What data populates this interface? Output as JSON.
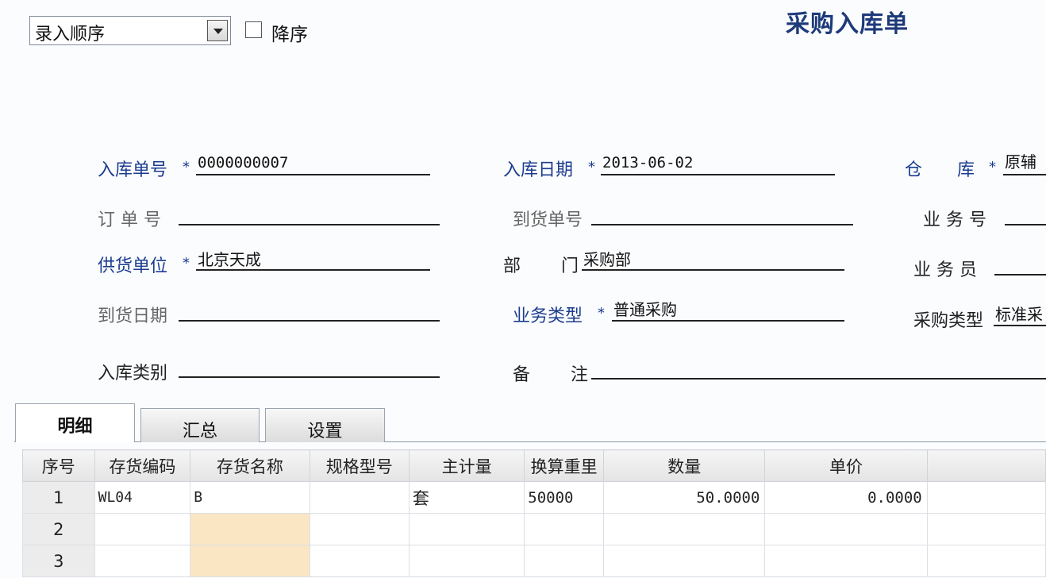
{
  "toolbar": {
    "sort_select_value": "录入顺序",
    "desc_label": "降序"
  },
  "form": {
    "title": "采购入库单",
    "fields": {
      "receipt_no": {
        "label": "入库单号",
        "required": true,
        "value": "0000000007"
      },
      "receipt_date": {
        "label": "入库日期",
        "required": true,
        "value": "2013-06-02"
      },
      "warehouse": {
        "label": "仓　　库",
        "required": true,
        "value": "原辅"
      },
      "order_no": {
        "label": "订 单 号",
        "value": ""
      },
      "arrival_no": {
        "label": "到货单号",
        "value": ""
      },
      "business_no": {
        "label": "业 务 号",
        "value": ""
      },
      "supplier": {
        "label": "供货单位",
        "required": true,
        "value": "北京天成"
      },
      "department": {
        "label_a": "部",
        "label_b": "门",
        "value": "采购部"
      },
      "salesperson": {
        "label": "业 务 员",
        "value": ""
      },
      "arrival_date": {
        "label": "到货日期",
        "value": ""
      },
      "business_type": {
        "label": "业务类型",
        "required": true,
        "value": "普通采购"
      },
      "purchase_type": {
        "label": "采购类型",
        "value": "标准采"
      },
      "receipt_category": {
        "label": "入库类别",
        "value": ""
      },
      "remarks": {
        "label_a": "备",
        "label_b": "注",
        "value": ""
      }
    },
    "required_mark": "*"
  },
  "tabs": [
    {
      "label": "明细",
      "active": true
    },
    {
      "label": "汇总",
      "active": false
    },
    {
      "label": "设置",
      "active": false
    }
  ],
  "grid": {
    "columns": [
      "序号",
      "存货编码",
      "存货名称",
      "规格型号",
      "主计量",
      "换算重里",
      "数量",
      "单价"
    ],
    "rows": [
      {
        "idx": "1",
        "code": "WL04",
        "name": "B",
        "spec": "",
        "unit": "套",
        "conv": "50000",
        "qty": "50.0000",
        "price": "0.0000"
      },
      {
        "idx": "2",
        "code": "",
        "name": "",
        "spec": "",
        "unit": "",
        "conv": "",
        "qty": "",
        "price": ""
      },
      {
        "idx": "3",
        "code": "",
        "name": "",
        "spec": "",
        "unit": "",
        "conv": "",
        "qty": "",
        "price": ""
      }
    ]
  },
  "colors": {
    "title": "#1d3a7a",
    "required_label": "#1b3c8f",
    "optional_label": "#666666",
    "highlight_cell": "#fbe6c4"
  }
}
